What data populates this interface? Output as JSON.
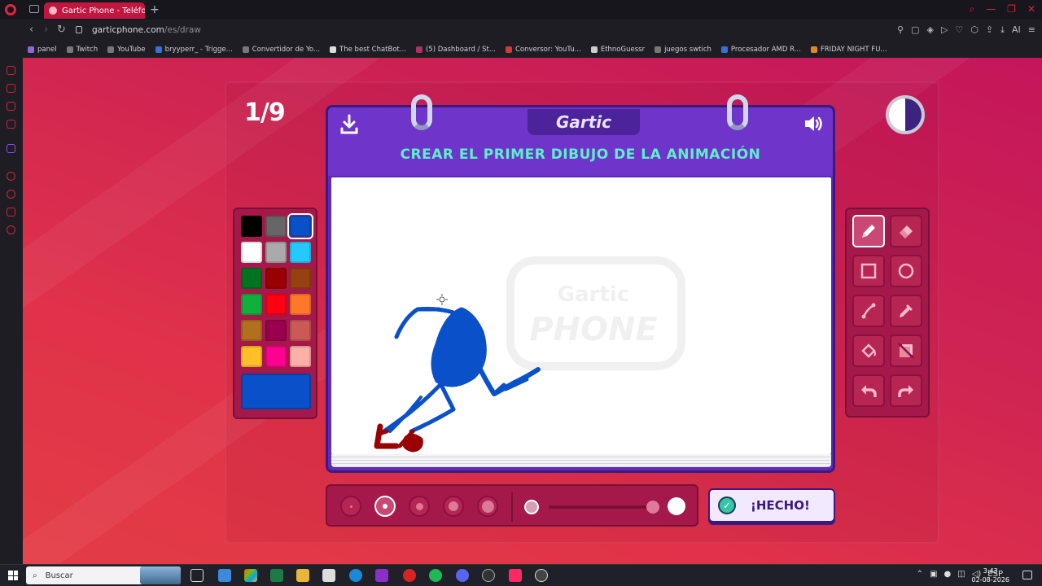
{
  "browser": {
    "tab_title": "Gartic Phone - Teléfono De",
    "url_host": "garticphone.com",
    "url_path": "/es/draw",
    "ai_label": "AI",
    "bookmarks": [
      "panel",
      "Twitch",
      "YouTube",
      "bryyperr_ - Trigge...",
      "Convertidor de Yo...",
      "The best ChatBot...",
      "(5) Dashboard / St...",
      "Conversor: YouTu...",
      "EthnoGuessr",
      "juegos swtich",
      "Procesador AMD R...",
      "FRIDAY NIGHT FU..."
    ]
  },
  "game": {
    "round": "1/9",
    "logo": "Gartic",
    "instruction": "CREAR EL PRIMER DIBUJO DE LA ANIMACIÓN",
    "done_label": "¡HECHO!",
    "watermark_top": "Gartic",
    "watermark_bottom": "PHONE",
    "timer_remaining_fraction": 0.5,
    "selected_color": "#0a50c8",
    "palette": [
      "#000000",
      "#666666",
      "#0a50c8",
      "#ffffff",
      "#aaaaaa",
      "#26c9ff",
      "#017420",
      "#990000",
      "#964112",
      "#11b03c",
      "#ff0013",
      "#ff7829",
      "#b0701c",
      "#99004e",
      "#cb5a57",
      "#ffc126",
      "#ff008f",
      "#feafa8"
    ],
    "tools": [
      "pencil-icon",
      "eraser-icon",
      "rectangle-icon",
      "ellipse-icon",
      "line-icon",
      "eyedropper-icon",
      "fill-icon",
      "clear-layer-icon",
      "undo-icon",
      "redo-icon"
    ],
    "brush_sizes_selected": 2,
    "opacity_value": 1
  },
  "taskbar": {
    "search_placeholder": "Buscar",
    "language": "ESP",
    "time": "3:43",
    "date": "02-08-2026"
  }
}
